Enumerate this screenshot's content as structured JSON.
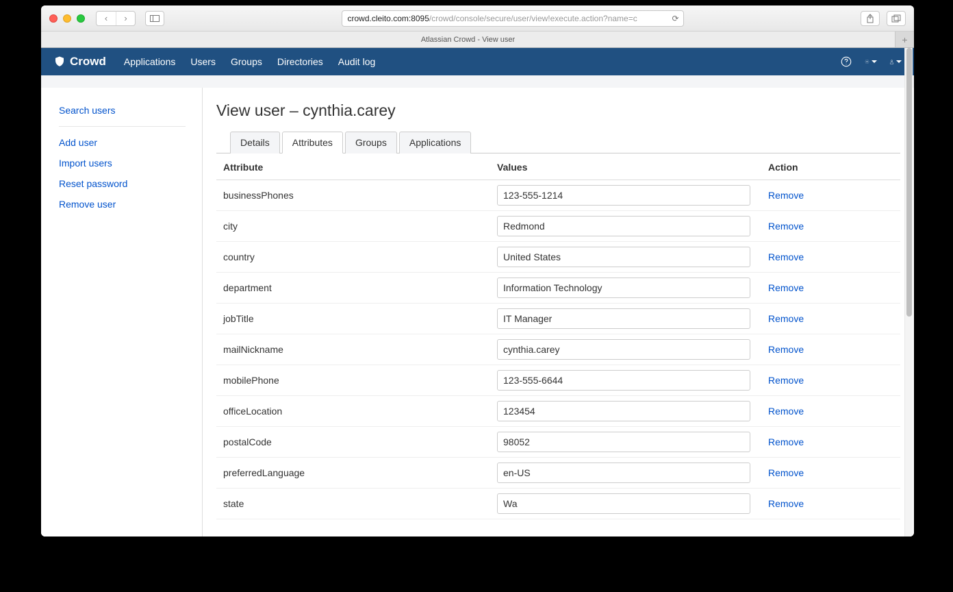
{
  "browser": {
    "url_prefix": "crowd.cleito.com:8095",
    "url_suffix": "/crowd/console/secure/user/view!execute.action?name=c",
    "tab_title": "Atlassian Crowd - View user"
  },
  "topnav": {
    "brand": "Crowd",
    "links": [
      "Applications",
      "Users",
      "Groups",
      "Directories",
      "Audit log"
    ]
  },
  "sidebar": {
    "primary": "Search users",
    "secondary": [
      "Add user",
      "Import users",
      "Reset password",
      "Remove user"
    ]
  },
  "page": {
    "title": "View user – cynthia.carey",
    "tabs": [
      "Details",
      "Attributes",
      "Groups",
      "Applications"
    ],
    "active_tab": 1
  },
  "table": {
    "headers": {
      "attribute": "Attribute",
      "values": "Values",
      "action": "Action"
    },
    "remove_label": "Remove",
    "rows": [
      {
        "attr": "businessPhones",
        "value": "123-555-1214"
      },
      {
        "attr": "city",
        "value": "Redmond"
      },
      {
        "attr": "country",
        "value": "United States"
      },
      {
        "attr": "department",
        "value": "Information Technology"
      },
      {
        "attr": "jobTitle",
        "value": "IT Manager"
      },
      {
        "attr": "mailNickname",
        "value": "cynthia.carey"
      },
      {
        "attr": "mobilePhone",
        "value": "123-555-6644"
      },
      {
        "attr": "officeLocation",
        "value": "123454"
      },
      {
        "attr": "postalCode",
        "value": "98052"
      },
      {
        "attr": "preferredLanguage",
        "value": "en-US"
      },
      {
        "attr": "state",
        "value": "Wa"
      }
    ]
  }
}
